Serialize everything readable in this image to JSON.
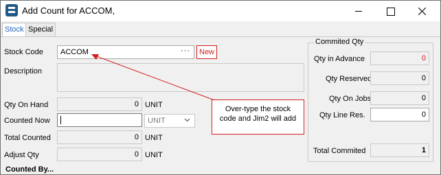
{
  "window": {
    "title": "Add Count for ACCOM,"
  },
  "tabs": [
    {
      "label": "Stock",
      "active": true
    },
    {
      "label": "Special",
      "active": false
    }
  ],
  "form": {
    "stock_code_label": "Stock Code",
    "stock_code_value": "ACCOM",
    "ellipsis_label": "···",
    "new_label": "New",
    "description_label": "Description",
    "description_value": "",
    "qty_on_hand_label": "Qty On Hand",
    "qty_on_hand_value": "0",
    "qty_on_hand_unit": "UNIT",
    "counted_now_label": "Counted Now",
    "counted_now_value": "",
    "counted_now_unit": "UNIT",
    "total_counted_label": "Total Counted",
    "total_counted_value": "0",
    "total_counted_unit": "UNIT",
    "adjust_qty_label": "Adjust Qty",
    "adjust_qty_value": "0",
    "adjust_qty_unit": "UNIT",
    "counted_by_label": "Counted By..."
  },
  "commited": {
    "title": "Commited Qty",
    "qty_in_advance_label": "Qty in Advance",
    "qty_in_advance_value": "0",
    "qty_reserved_label": "Qty Reserved",
    "qty_reserved_value": "0",
    "qty_on_jobs_label": "Qty On Jobs",
    "qty_on_jobs_value": "0",
    "qty_line_res_label": "Qty Line Res.",
    "qty_line_res_value": "0",
    "total_label": "Total Commited",
    "total_value": "1"
  },
  "callout": {
    "text": "Over-type the stock code and Jim2 will add"
  },
  "colors": {
    "accent": "#1e63b8",
    "annotation": "#d21e1e"
  },
  "icons": [
    "app-icon",
    "minimize-icon",
    "maximize-icon",
    "close-icon",
    "chevron-down-icon"
  ]
}
